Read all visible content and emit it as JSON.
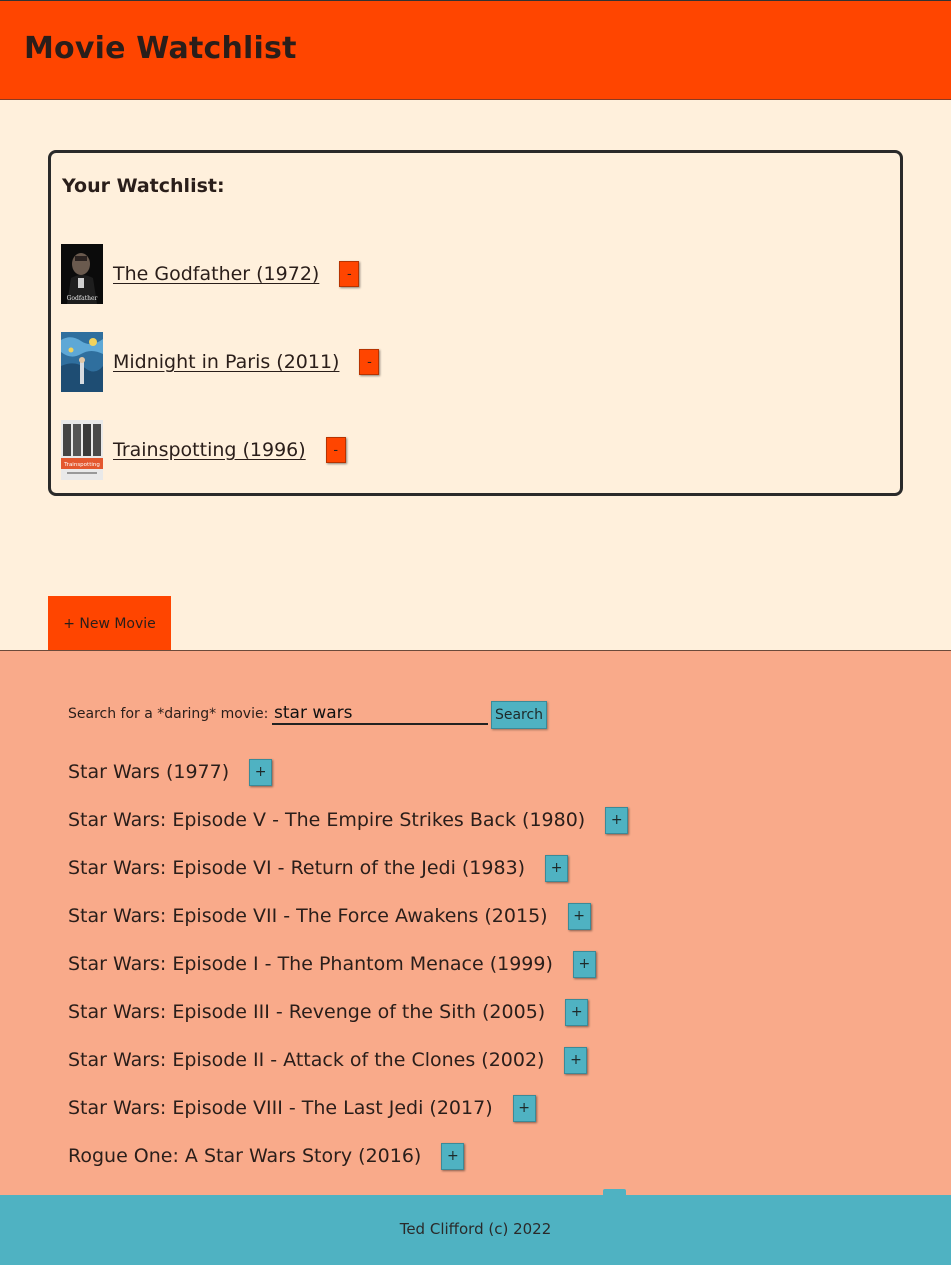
{
  "header": {
    "title": "Movie Watchlist"
  },
  "watchlist": {
    "heading": "Your Watchlist:",
    "remove_label": "-",
    "items": [
      {
        "title": "The Godfather (1972)",
        "poster_icon": "godfather-poster"
      },
      {
        "title": "Midnight in Paris (2011)",
        "poster_icon": "midnight-in-paris-poster"
      },
      {
        "title": "Trainspotting (1996)",
        "poster_icon": "trainspotting-poster"
      }
    ]
  },
  "new_movie_button": "+ New Movie",
  "search": {
    "label": "Search for a *daring* movie:",
    "value": "star wars",
    "button_label": "Search",
    "add_label": "+",
    "results": [
      "Star Wars (1977)",
      "Star Wars: Episode V - The Empire Strikes Back (1980)",
      "Star Wars: Episode VI - Return of the Jedi (1983)",
      "Star Wars: Episode VII - The Force Awakens (2015)",
      "Star Wars: Episode I - The Phantom Menace (1999)",
      "Star Wars: Episode III - Revenge of the Sith (2005)",
      "Star Wars: Episode II - Attack of the Clones (2002)",
      "Star Wars: Episode VIII - The Last Jedi (2017)",
      "Rogue One: A Star Wars Story (2016)"
    ]
  },
  "footer": {
    "text": "Ted Clifford (c) 2022"
  },
  "colors": {
    "header_bg": "#ff4500",
    "page_bg": "#fff0dc",
    "search_bg": "#f9aa8a",
    "accent_teal": "#4fb2c2"
  }
}
